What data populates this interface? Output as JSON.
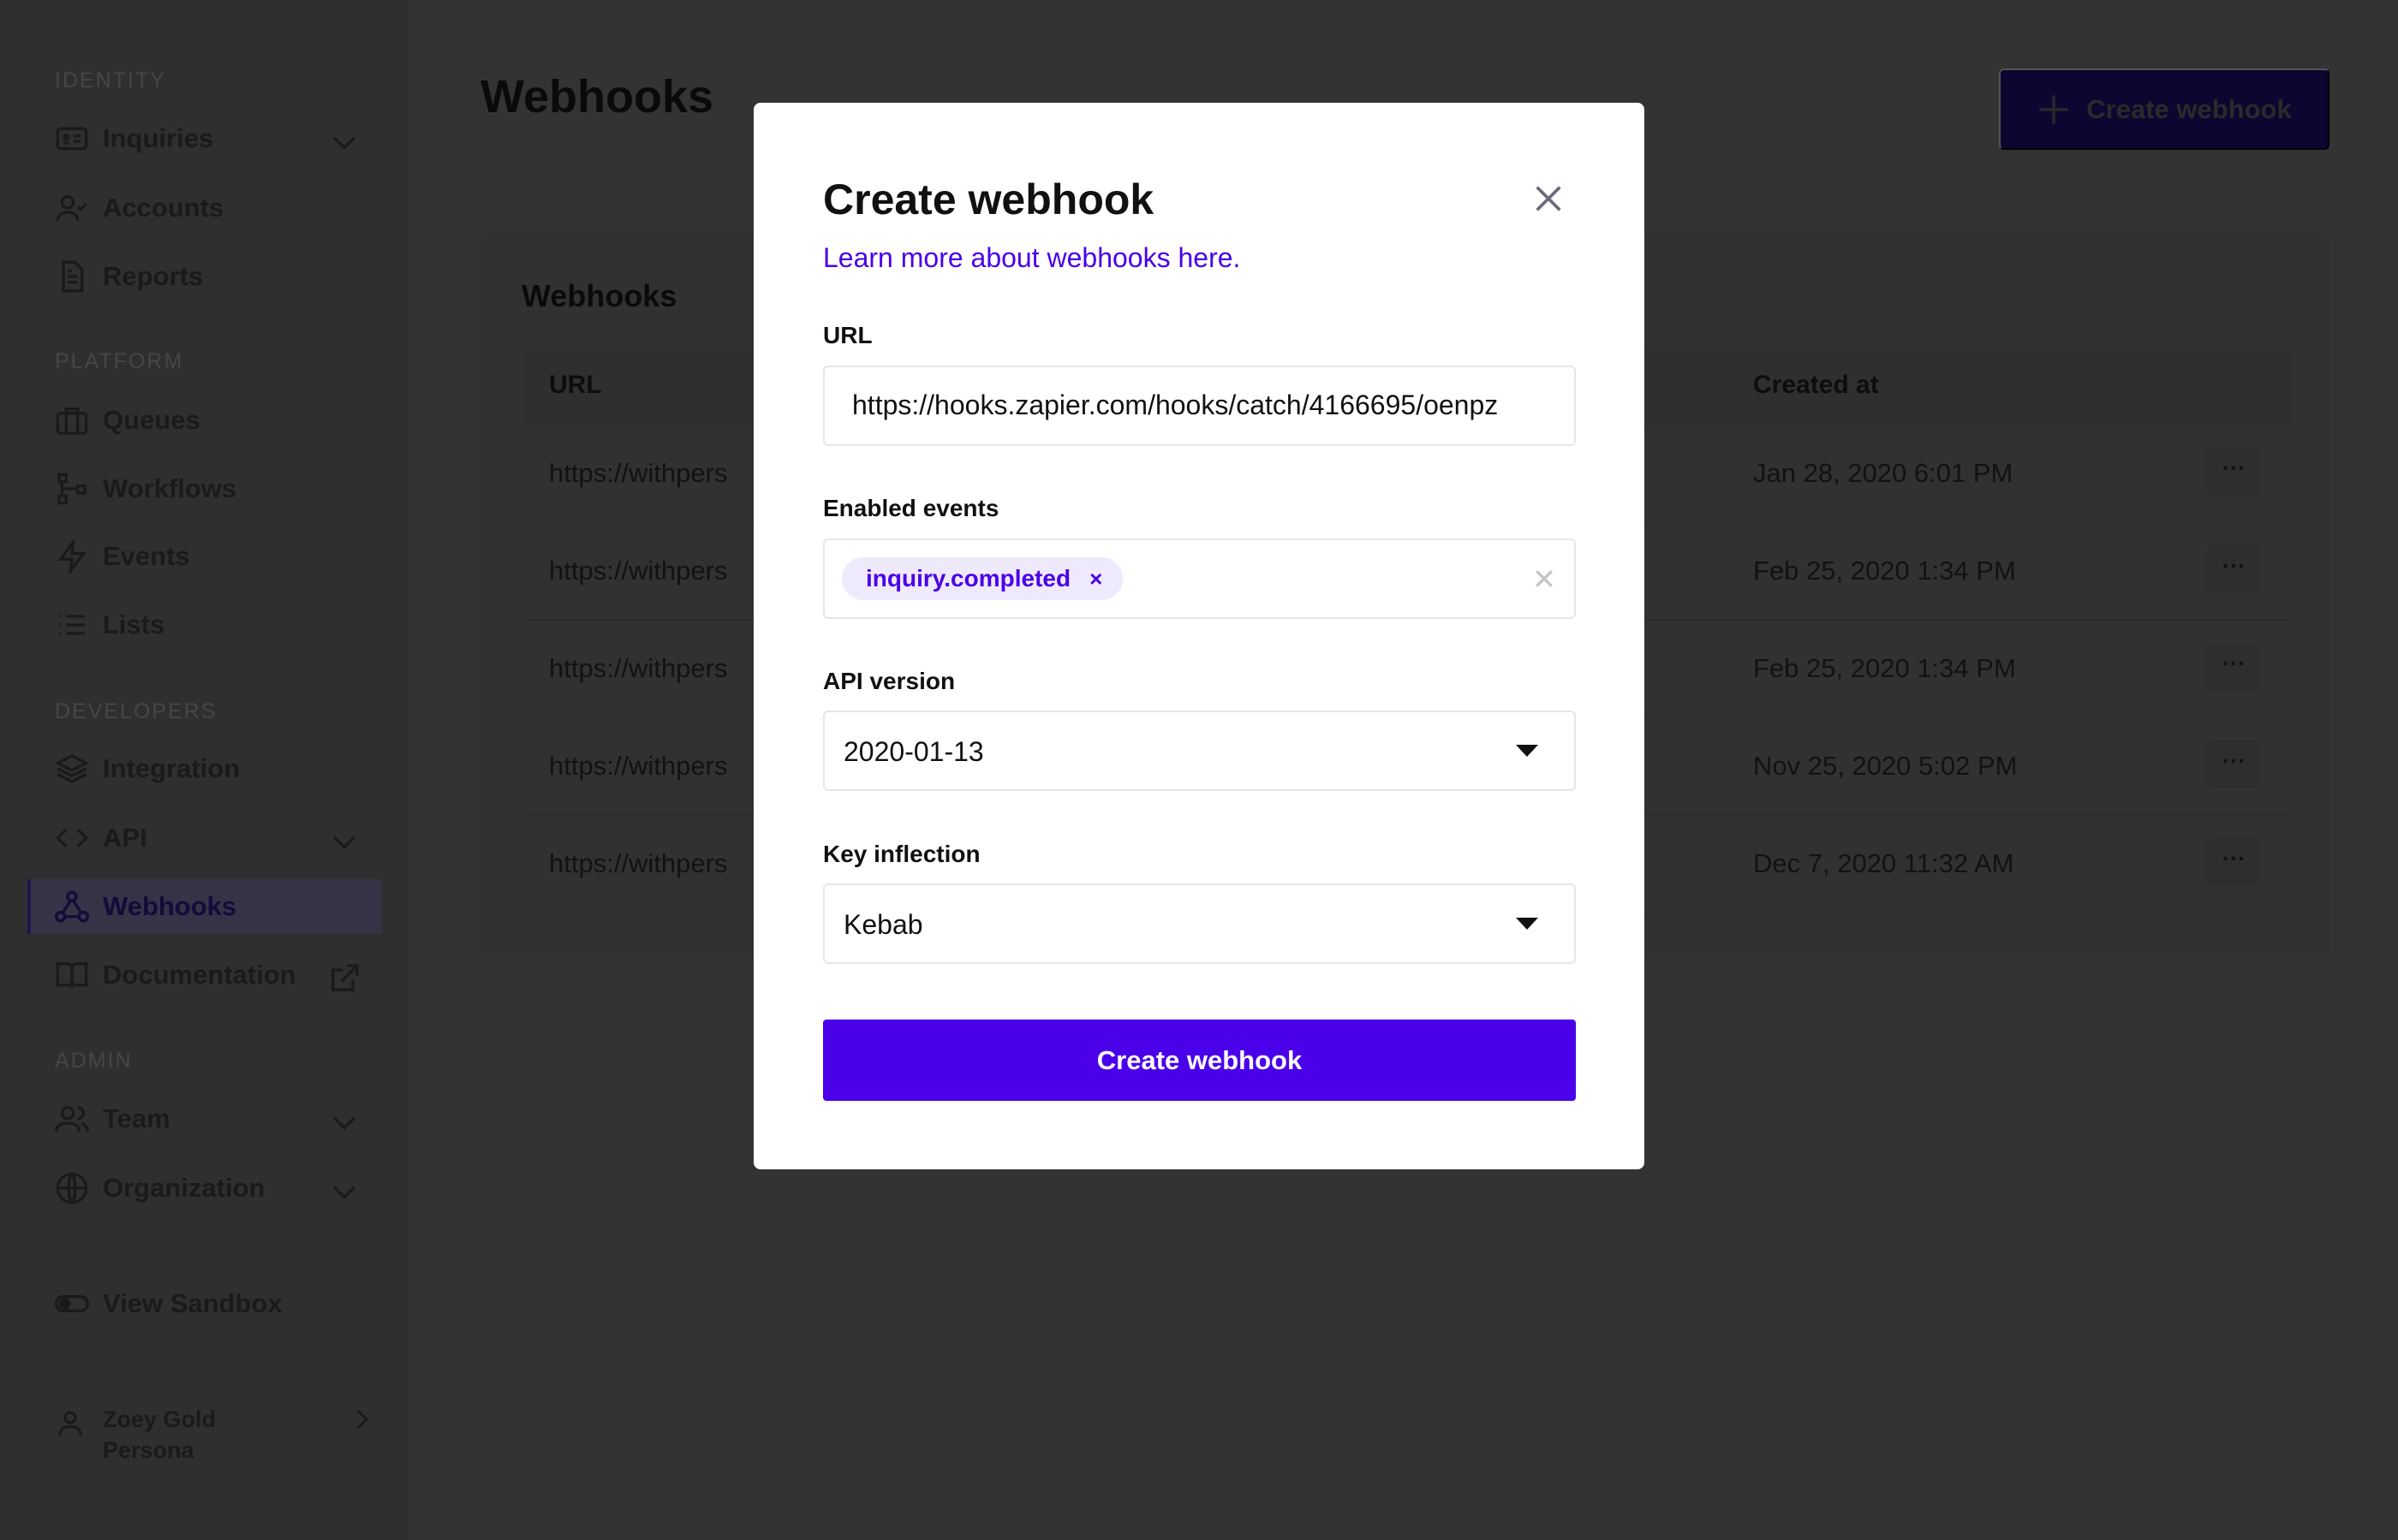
{
  "sidebar": {
    "sections": [
      "IDENTITY",
      "PLATFORM",
      "DEVELOPERS",
      "ADMIN"
    ],
    "items": [
      {
        "label": "Inquiries",
        "icon": "id-card-icon"
      },
      {
        "label": "Accounts",
        "icon": "user-check-icon"
      },
      {
        "label": "Reports",
        "icon": "document-icon"
      },
      {
        "label": "Queues",
        "icon": "briefcase-icon"
      },
      {
        "label": "Workflows",
        "icon": "workflow-icon"
      },
      {
        "label": "Events",
        "icon": "lightning-icon"
      },
      {
        "label": "Lists",
        "icon": "list-icon"
      },
      {
        "label": "Integration",
        "icon": "layers-icon"
      },
      {
        "label": "API",
        "icon": "code-icon"
      },
      {
        "label": "Webhooks",
        "icon": "webhook-icon",
        "active": true
      },
      {
        "label": "Documentation",
        "icon": "book-icon"
      },
      {
        "label": "Team",
        "icon": "users-icon"
      },
      {
        "label": "Organization",
        "icon": "globe-icon"
      },
      {
        "label": "View Sandbox",
        "icon": "toggle-icon"
      }
    ],
    "user": {
      "name": "Zoey Gold",
      "org": "Persona"
    }
  },
  "main": {
    "title": "Webhooks",
    "create_button": "Create webhook",
    "card_title": "Webhooks",
    "columns": {
      "url": "URL",
      "created_at": "Created at"
    },
    "rows": [
      {
        "url": "https://withpers",
        "created_at": "Jan 28, 2020 6:01 PM"
      },
      {
        "url": "https://withpers",
        "created_at": "Feb 25, 2020 1:34 PM"
      },
      {
        "url": "https://withpers",
        "created_at": "Feb 25, 2020 1:34 PM"
      },
      {
        "url": "https://withpers",
        "created_at": "Nov 25, 2020 5:02 PM"
      },
      {
        "url": "https://withpers",
        "created_at": "Dec 7, 2020 11:32 AM"
      }
    ],
    "row_menu": "···"
  },
  "modal": {
    "title": "Create webhook",
    "link": "Learn more about webhooks here.",
    "url_label": "URL",
    "url_value": "https://hooks.zapier.com/hooks/catch/4166695/oenpz",
    "events_label": "Enabled events",
    "events": [
      "inquiry.completed"
    ],
    "chip_remove": "×",
    "api_label": "API version",
    "api_value": "2020-01-13",
    "key_label": "Key inflection",
    "key_value": "Kebab",
    "submit": "Create webhook",
    "accent": "#4a00e8"
  }
}
